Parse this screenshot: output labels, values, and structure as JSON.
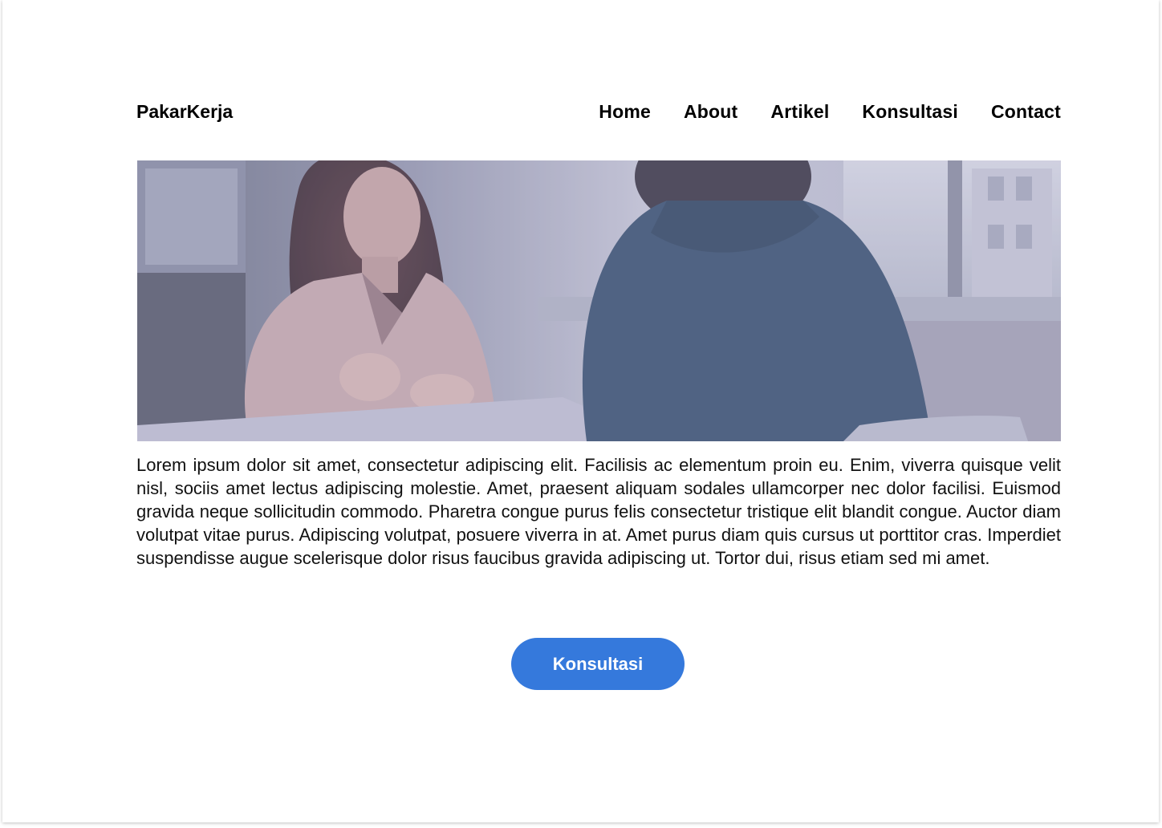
{
  "header": {
    "brand": "PakarKerja",
    "nav": [
      "Home",
      "About",
      "Artikel",
      "Konsultasi",
      "Contact"
    ]
  },
  "hero": {
    "image": "photo-two-women-consultation-interview",
    "overlay_color": "#a7a8c8"
  },
  "main": {
    "paragraph": "Lorem ipsum dolor sit amet, consectetur adipiscing elit. Facilisis ac elementum proin eu. Enim, viverra quisque velit nisl, sociis amet lectus adipiscing molestie. Amet, praesent aliquam sodales ullamcorper nec dolor facilisi. Euismod gravida neque sollicitudin commodo. Pharetra congue purus felis consectetur tristique elit blandit congue. Auctor diam volutpat vitae purus. Adipiscing volutpat, posuere viverra in at. Amet purus diam quis cursus ut porttitor cras. Imperdiet suspendisse augue scelerisque dolor risus faucibus gravida adipiscing ut. Tortor dui, risus etiam sed mi amet."
  },
  "cta": {
    "label": "Konsultasi",
    "color": "#3579dc"
  }
}
